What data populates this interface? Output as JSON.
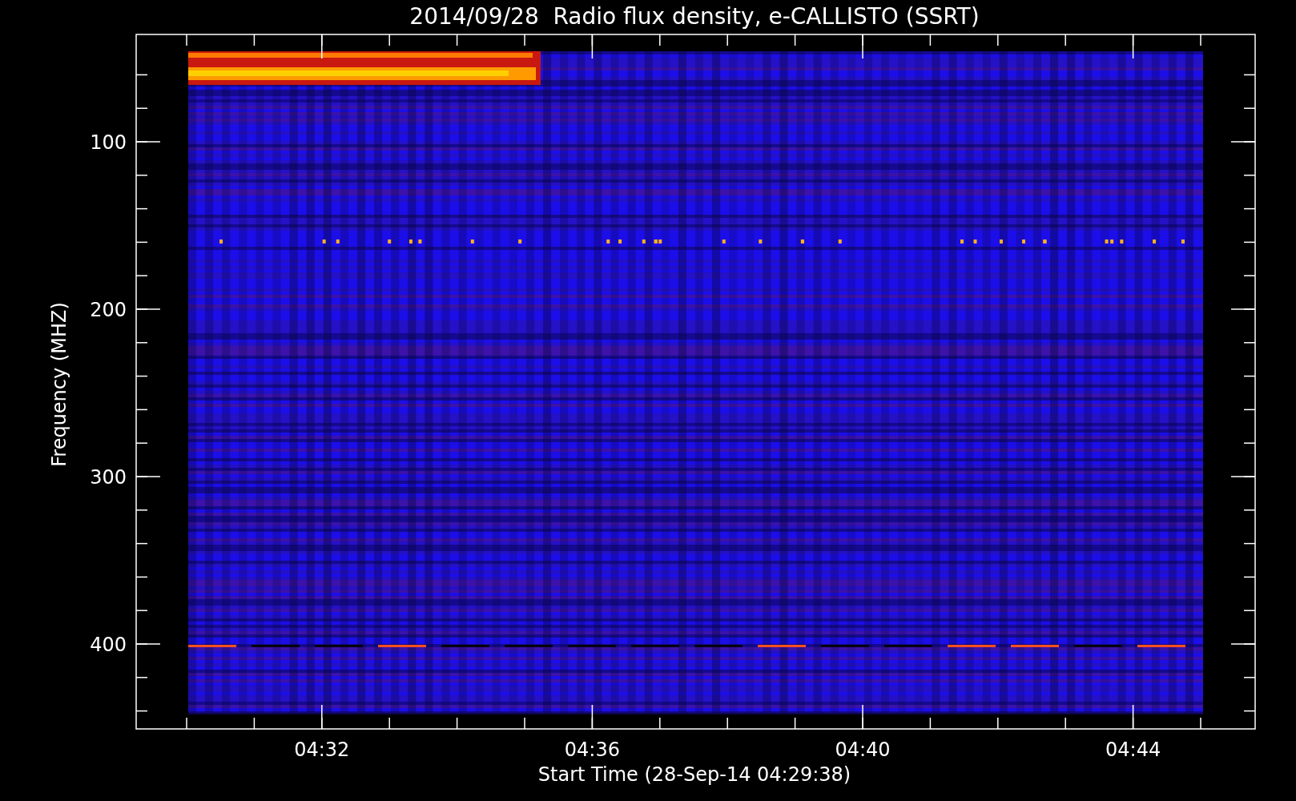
{
  "title": "2014/09/28  Radio flux density, e-CALLISTO (SSRT)",
  "y_axis": {
    "label": "Frequency (MHZ)",
    "ticks": [
      "100",
      "200",
      "300",
      "400"
    ]
  },
  "x_axis": {
    "label": "Start Time (28-Sep-14 04:29:38)",
    "ticks": [
      "04:32",
      "04:36",
      "04:40",
      "04:44"
    ]
  }
}
